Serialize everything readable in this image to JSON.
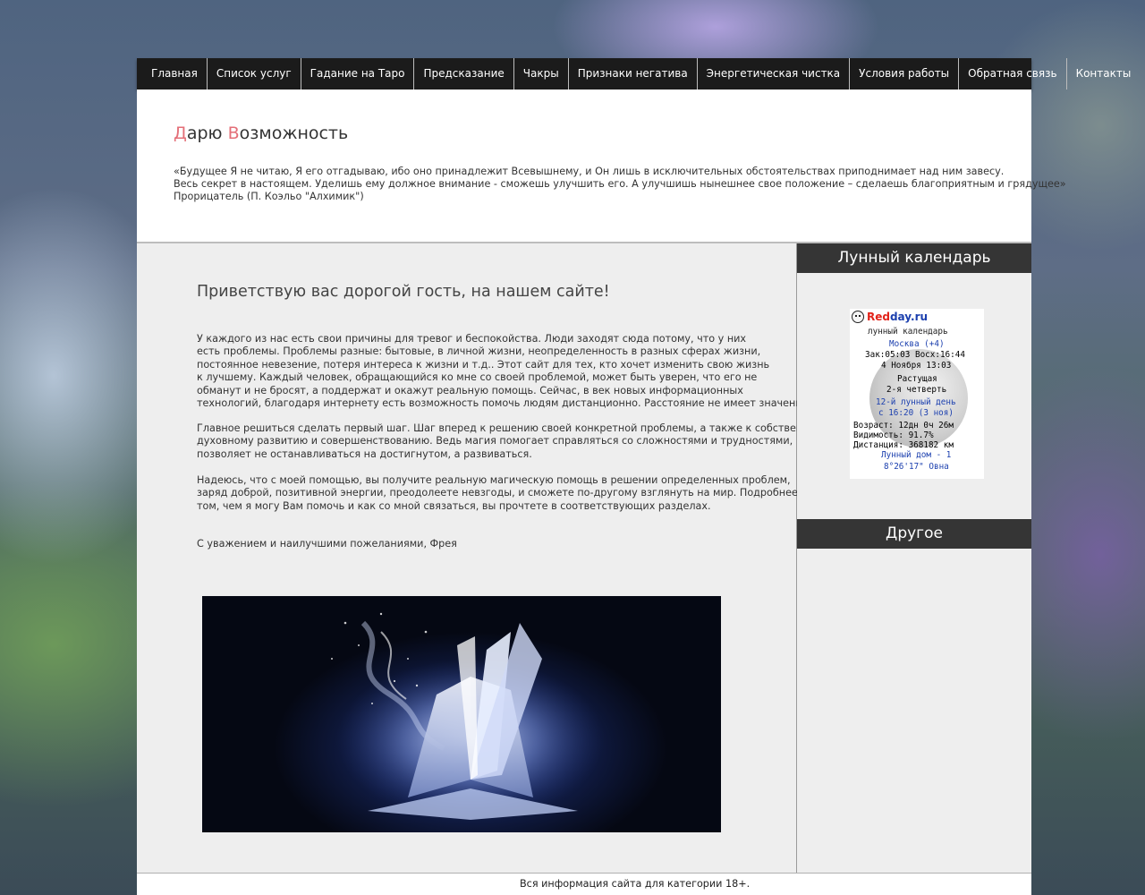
{
  "nav": {
    "items": [
      {
        "label": "Главная"
      },
      {
        "label": "Список услуг"
      },
      {
        "label": "Гадание на Таро"
      },
      {
        "label": "Предсказание"
      },
      {
        "label": "Чакры"
      },
      {
        "label": "Признаки негатива"
      },
      {
        "label": "Энергетическая чистка"
      },
      {
        "label": "Условия работы"
      },
      {
        "label": "Обратная связь"
      },
      {
        "label": "Контакты"
      }
    ]
  },
  "header": {
    "title_first_letter_1": "Д",
    "title_rest_1": "арю ",
    "title_first_letter_2": "В",
    "title_rest_2": "озможность",
    "quote_lines": [
      "«Будущее Я не читаю, Я его отгадываю, ибо оно принадлежит Всевышнему, и Он лишь в исключительных обстоятельствах приподнимает над ним завесу.",
      "Весь секрет в настоящем. Уделишь ему должное внимание - сможешь улучшить его. А улучшишь нынешнее свое положение – сделаешь благоприятным и грядущее»",
      "Прорицатель (П. Коэльо \"Алхимик\")"
    ]
  },
  "main": {
    "greeting": "Приветствую вас дорогой гость, на нашем сайте!",
    "paragraph_1": [
      "У каждого из нас есть свои причины для тревог и беспокойства. Люди заходят сюда потому, что у них",
      "есть проблемы. Проблемы разные: бытовые, в личной жизни, неопределенность в разных сферах жизни,",
      "постоянное невезение, потеря интереса к жизни и т.д.. Этот сайт для тех, кто хочет изменить свою жизнь",
      "к лучшему. Каждый человек, обращающийся ко мне со своей проблемой, может быть уверен, что его не",
      "обманут и не бросят, а поддержат и окажут реальную помощь. Сейчас, в век новых информационных",
      "технологий, благодаря интернету есть возможность помочь людям дистанционно. Расстояние не имеет значения."
    ],
    "paragraph_2": [
      "Главное решиться сделать первый шаг. Шаг вперед к решению своей конкретной проблемы, а также к собственному",
      " духовному развитию и совершенствованию. Ведь магия помогает справляться со сложностями и трудностями,",
      "позволяет не останавливаться на достигнутом, а развиваться."
    ],
    "paragraph_3": [
      "Надеюсь, что с моей помощью, вы получите реальную магическую помощь в решении определенных проблем,",
      "заряд доброй, позитивной энергии, преодолеете невзгоды, и сможете по-другому взглянуть на мир. Подробнее о",
      "том, чем я могу Вам помочь и как со мной связаться, вы прочтете в соответствующих разделах."
    ],
    "signature": "С уважением и наилучшими пожеланиями, Фрея"
  },
  "sidebar": {
    "moon_title": "Лунный календарь",
    "other_title": "Другое",
    "moon": {
      "logo_red": "Red",
      "logo_rest": "day.ru",
      "subtitle": "лунный календарь",
      "city": "Москва (+4)",
      "sun_times": "Зак:05:03 Восх:16:44",
      "date": "4 Ноября 13:03",
      "phase_1": "Растущая",
      "phase_2": "2-я четверть",
      "lunar_day": "12-й лунный день",
      "lunar_day_start": "с 16:20 (3 ноя)",
      "age": "Возраст: 12дн 0ч 26м",
      "visibility": "Видимость: 91.7%",
      "distance": "Дистанция: 368182 км",
      "house": "Лунный дом - 1",
      "position": "8°26'17\" Овна"
    }
  },
  "footer": {
    "text": "Вся информация сайта для категории 18+."
  }
}
